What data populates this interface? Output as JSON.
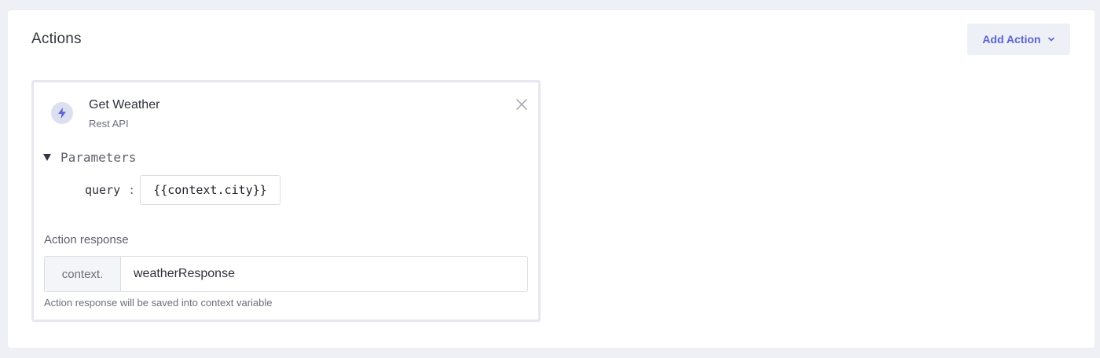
{
  "panel": {
    "title": "Actions",
    "add_action_label": "Add Action"
  },
  "action": {
    "name": "Get Weather",
    "type": "Rest API",
    "icon": "lightning-bolt-icon",
    "parameters_label": "Parameters",
    "parameters": [
      {
        "key": "query",
        "separator": ":",
        "value": "{{context.city}}"
      }
    ],
    "response_label": "Action response",
    "response_prefix": "context.",
    "response_value": "weatherResponse",
    "response_help": "Action response will be saved into context variable"
  },
  "colors": {
    "accent": "#5a62d6",
    "background": "#eff0f5",
    "card_border": "#e6e7f1"
  }
}
